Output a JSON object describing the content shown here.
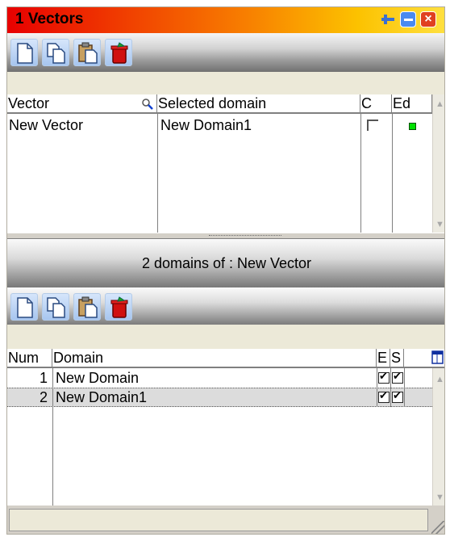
{
  "window": {
    "title": "1  Vectors",
    "close_glyph": "×"
  },
  "toolbar_icons": [
    "new-icon",
    "copy-icon",
    "paste-icon",
    "delete-icon"
  ],
  "vectors_grid": {
    "headers": {
      "vector": "Vector",
      "domain": "Selected domain",
      "c": "C",
      "ed": "Ed"
    },
    "rows": [
      {
        "vector": "New Vector",
        "domain": "New Domain1",
        "c": false,
        "ed": true
      }
    ]
  },
  "domains_panel": {
    "caption": "2 domains of : New Vector"
  },
  "domains_grid": {
    "headers": {
      "num": "Num",
      "domain": "Domain",
      "e": "E",
      "s": "S"
    },
    "rows": [
      {
        "num": "1",
        "domain": "New Domain",
        "e": true,
        "s": true
      },
      {
        "num": "2",
        "domain": "New Domain1",
        "e": true,
        "s": true
      }
    ]
  },
  "colors": {
    "accent_green": "#00e000",
    "title_gradient_start": "#e80000",
    "title_gradient_end": "#ffe040"
  }
}
